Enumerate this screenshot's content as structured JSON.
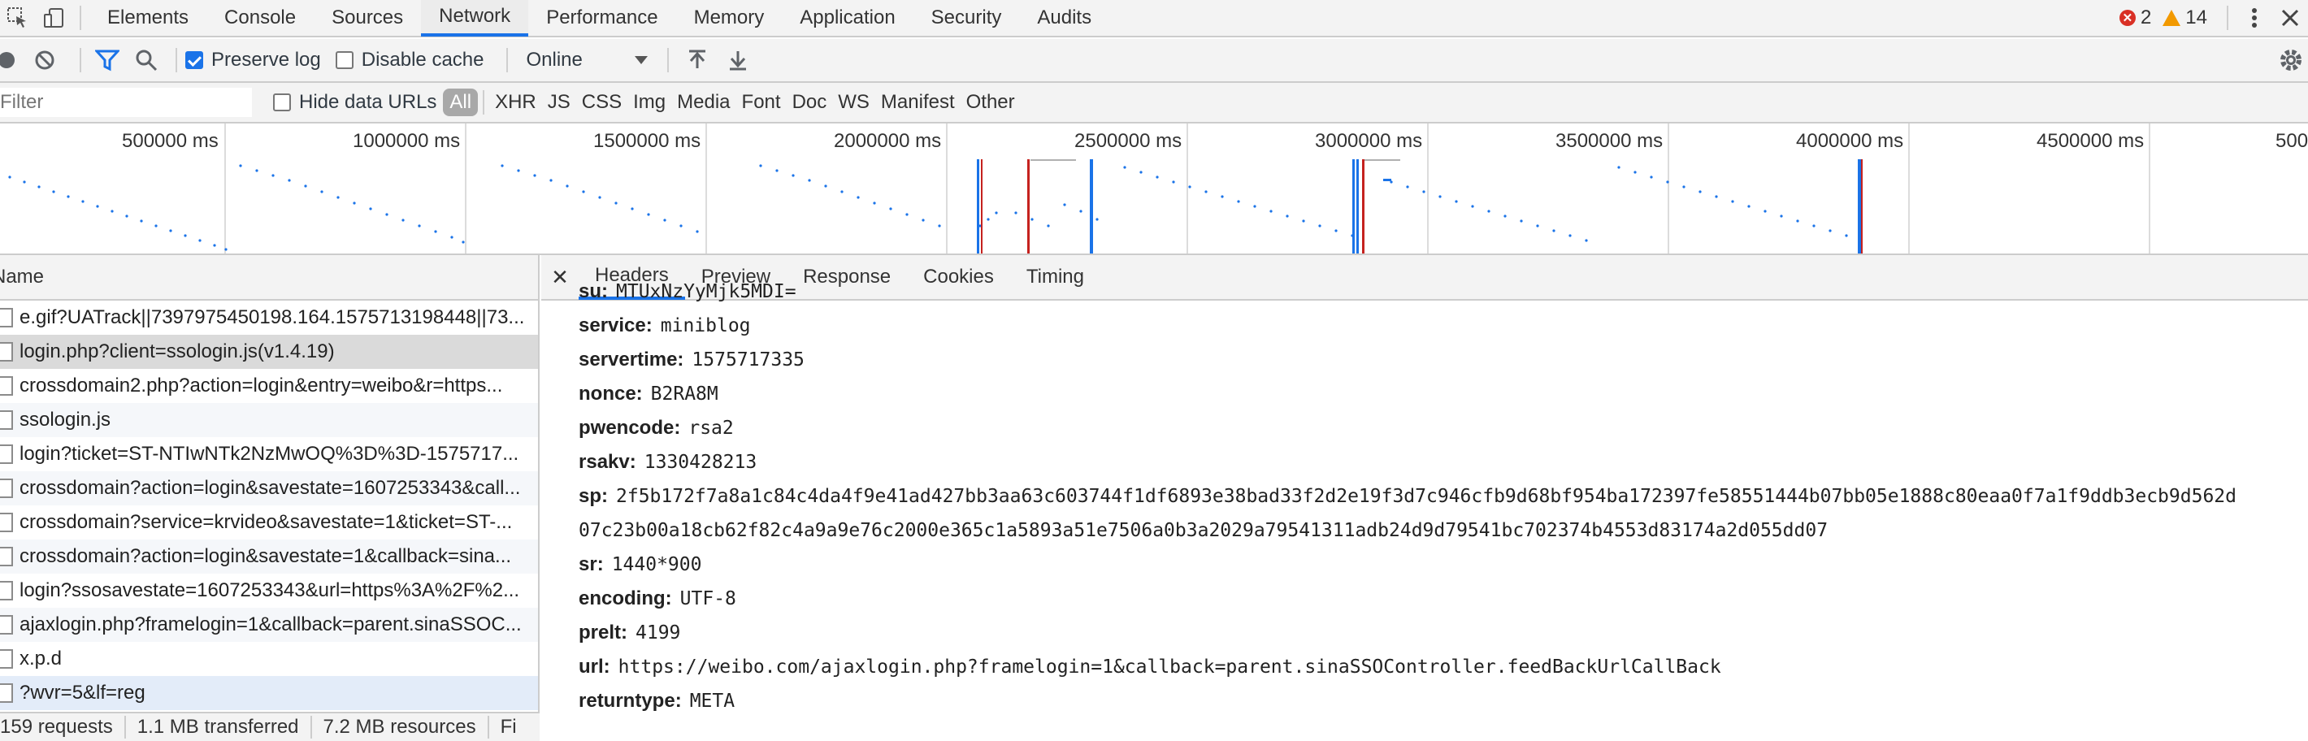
{
  "tabs": [
    "Elements",
    "Console",
    "Sources",
    "Network",
    "Performance",
    "Memory",
    "Application",
    "Security",
    "Audits"
  ],
  "active_tab": "Network",
  "errors_count": "2",
  "warnings_count": "14",
  "toolbar": {
    "preserve_log_label": "Preserve log",
    "disable_cache_label": "Disable cache",
    "throttle_value": "Online"
  },
  "filter": {
    "placeholder": "Filter",
    "hide_data_urls_label": "Hide data URLs",
    "types": [
      "All",
      "XHR",
      "JS",
      "CSS",
      "Img",
      "Media",
      "Font",
      "Doc",
      "WS",
      "Manifest",
      "Other"
    ]
  },
  "overview": {
    "labels": [
      "500000 ms",
      "1000000 ms",
      "1500000 ms",
      "2000000 ms",
      "2500000 ms",
      "3000000 ms",
      "3500000 ms",
      "4000000 ms",
      "4500000 ms",
      "500"
    ]
  },
  "requests": {
    "header": "Name",
    "items": [
      "e.gif?UATrack||7397975450198.164.1575713198448||73...",
      "login.php?client=ssologin.js(v1.4.19)",
      "crossdomain2.php?action=login&entry=weibo&r=https...",
      "ssologin.js",
      "login?ticket=ST-NTIwNTk2NzMwOQ%3D%3D-1575717...",
      "crossdomain?action=login&savestate=1607253343&call...",
      "crossdomain?service=krvideo&savestate=1&ticket=ST-...",
      "crossdomain?action=login&savestate=1&callback=sina...",
      "login?ssosavestate=1607253343&url=https%3A%2F%2...",
      "ajaxlogin.php?framelogin=1&callback=parent.sinaSSOC...",
      "x.p.d",
      "?wvr=5&lf=reg"
    ],
    "status": [
      "159 requests",
      "1.1 MB transferred",
      "7.2 MB resources",
      "Fi"
    ]
  },
  "details": {
    "tabs": [
      "Headers",
      "Preview",
      "Response",
      "Cookies",
      "Timing"
    ],
    "active_tab": "Headers",
    "params": [
      {
        "key": "su:",
        "value": "MTUxNzYyMjk5MDI="
      },
      {
        "key": "service:",
        "value": "miniblog"
      },
      {
        "key": "servertime:",
        "value": "1575717335"
      },
      {
        "key": "nonce:",
        "value": "B2RA8M"
      },
      {
        "key": "pwencode:",
        "value": "rsa2"
      },
      {
        "key": "rsakv:",
        "value": "1330428213"
      },
      {
        "key": "sp:",
        "value": "2f5b172f7a8a1c84c4da4f9e41ad427bb3aa63c603744f1df6893e38bad33f2d2e19f3d7c946cfb9d68bf954ba172397fe58551444b07bb05e1888c80eaa0f7a1f9ddb3ecb9d562d",
        "value2": "07c23b00a18cb62f82c4a9a9e76c2000e365c1a5893a51e7506a0b3a2029a79541311adb24d9d79541bc702374b4553d83174a2d055dd07"
      },
      {
        "key": "sr:",
        "value": "1440*900"
      },
      {
        "key": "encoding:",
        "value": "UTF-8"
      },
      {
        "key": "prelt:",
        "value": "4199"
      },
      {
        "key": "url:",
        "value": "https://weibo.com/ajaxlogin.php?framelogin=1&callback=parent.sinaSSOController.feedBackUrlCallBack"
      },
      {
        "key": "returntype:",
        "value": "META"
      }
    ]
  },
  "colors": {
    "accent": "#1a73e8",
    "error": "#d93025",
    "warning": "#f29900",
    "timeline_blue": "#1a73e8",
    "timeline_red": "#c5221f"
  }
}
